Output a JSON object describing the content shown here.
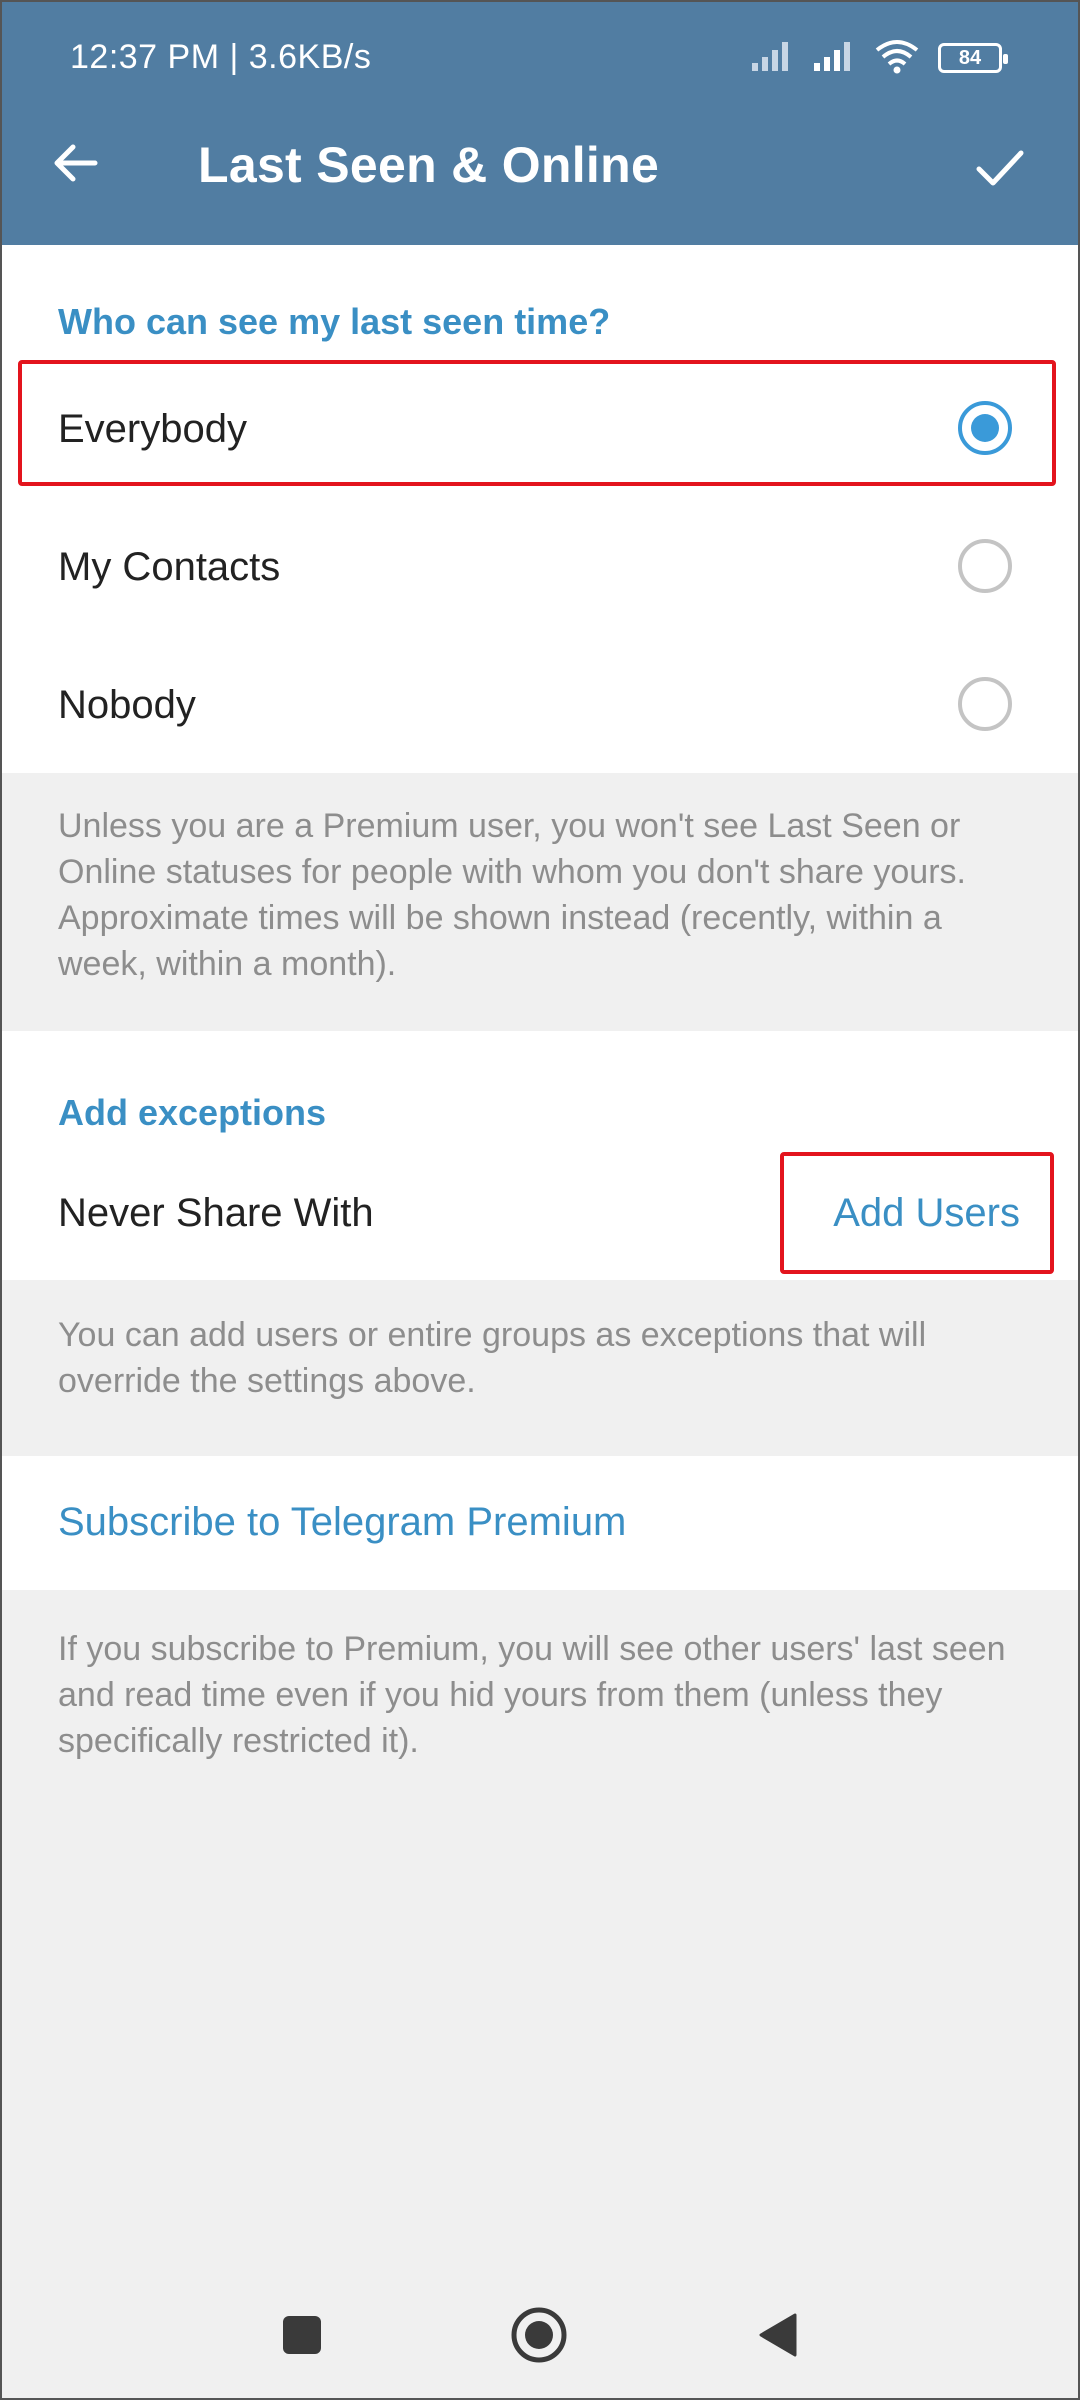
{
  "status_bar": {
    "time": "12:37 PM | 3.6KB/s",
    "battery": "84",
    "icons": [
      "signal-icon",
      "signal-icon",
      "wifi-icon",
      "battery-icon"
    ]
  },
  "app_bar": {
    "title": "Last Seen & Online",
    "back_icon": "back-arrow-icon",
    "confirm_icon": "checkmark-icon",
    "background": "#517da2"
  },
  "last_seen": {
    "header": "Who can see my last seen time?",
    "options": [
      {
        "label": "Everybody",
        "selected": true
      },
      {
        "label": "My Contacts",
        "selected": false
      },
      {
        "label": "Nobody",
        "selected": false
      }
    ],
    "info": "Unless you are a Premium user, you won't see Last Seen or Online statuses for people with whom you don't share yours. Approximate times will be shown instead (recently, within a week, within a month)."
  },
  "exceptions": {
    "header": "Add exceptions",
    "never_share_label": "Never Share With",
    "add_users_label": "Add Users",
    "info": "You can add users or entire groups as exceptions that will override the settings above."
  },
  "premium": {
    "link": "Subscribe to Telegram Premium",
    "info": "If you subscribe to Premium, you will see other users' last seen and read time even if you hid yours from them (unless they specifically restricted it)."
  },
  "nav_bar": {
    "icons": [
      "recents-square-icon",
      "home-circle-icon",
      "back-triangle-icon"
    ]
  },
  "colors": {
    "accent": "#3a8fc4",
    "radio_selected": "#3a9ad9",
    "highlight": "#e3141d"
  }
}
